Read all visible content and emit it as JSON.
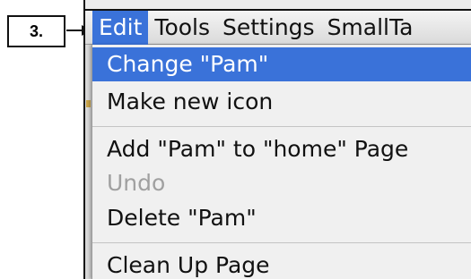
{
  "step_label": "3.",
  "menubar": {
    "items": [
      {
        "label": "Edit",
        "active": true
      },
      {
        "label": "Tools"
      },
      {
        "label": "Settings"
      },
      {
        "label": "SmallTa"
      }
    ]
  },
  "edit_menu": {
    "items": [
      {
        "label": "Change \"Pam\"",
        "highlighted": true
      },
      {
        "label": "Make new icon"
      },
      {
        "label": "Add \"Pam\" to \"home\" Page"
      },
      {
        "label": "Undo",
        "disabled": true
      },
      {
        "label": "Delete \"Pam\""
      },
      {
        "label": "Clean Up Page"
      }
    ]
  },
  "colors": {
    "highlight": "#3a72d9",
    "disabled_text": "#a0a0a0",
    "menu_bg": "#f0f0f0"
  }
}
